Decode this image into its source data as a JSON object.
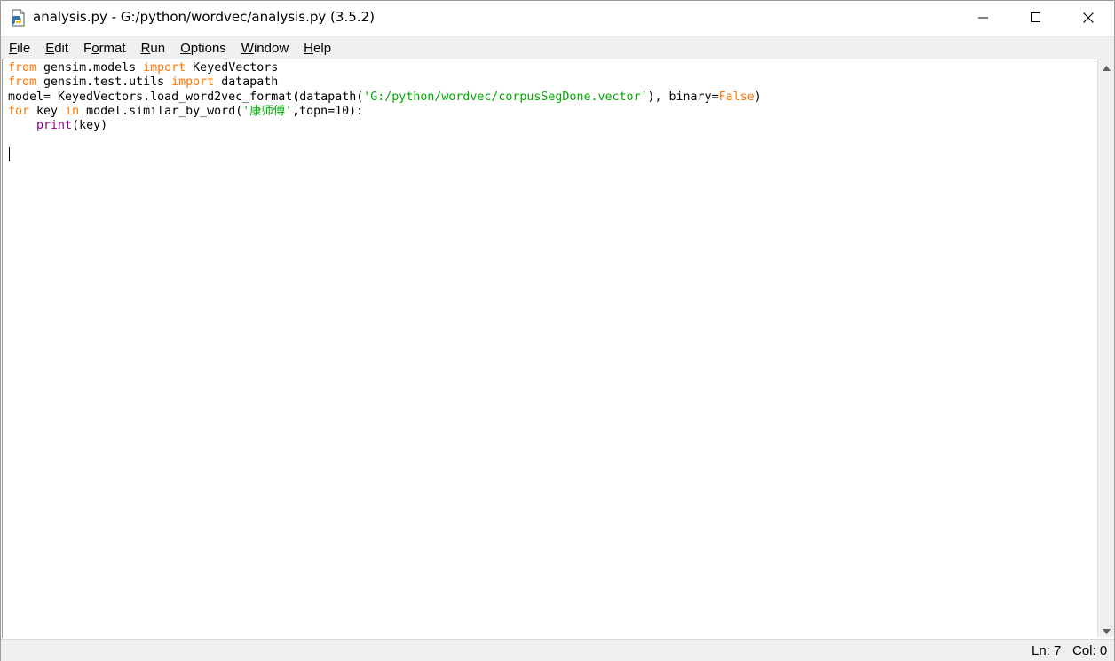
{
  "window": {
    "title": "analysis.py - G:/python/wordvec/analysis.py (3.5.2)",
    "minimize_icon": "minimize-icon",
    "maximize_icon": "maximize-icon",
    "close_icon": "close-icon"
  },
  "menu": [
    {
      "before": "",
      "accel": "F",
      "after": "ile"
    },
    {
      "before": "",
      "accel": "E",
      "after": "dit"
    },
    {
      "before": "F",
      "accel": "o",
      "after": "rmat"
    },
    {
      "before": "",
      "accel": "R",
      "after": "un"
    },
    {
      "before": "",
      "accel": "O",
      "after": "ptions"
    },
    {
      "before": "",
      "accel": "W",
      "after": "indow"
    },
    {
      "before": "",
      "accel": "H",
      "after": "elp"
    }
  ],
  "code": {
    "lines": [
      [
        [
          "kw",
          "from"
        ],
        [
          "n",
          " gensim.models "
        ],
        [
          "kw",
          "import"
        ],
        [
          "n",
          " KeyedVectors"
        ]
      ],
      [
        [
          "kw",
          "from"
        ],
        [
          "n",
          " gensim.test.utils "
        ],
        [
          "kw",
          "import"
        ],
        [
          "n",
          " datapath"
        ]
      ],
      [
        [
          "n",
          "model= KeyedVectors.load_word2vec_format(datapath("
        ],
        [
          "str",
          "'G:/python/wordvec/corpusSegDone.vector'"
        ],
        [
          "n",
          "), binary="
        ],
        [
          "kw",
          "False"
        ],
        [
          "n",
          ")"
        ]
      ],
      [
        [
          "kw",
          "for"
        ],
        [
          "n",
          " key "
        ],
        [
          "kw",
          "in"
        ],
        [
          "n",
          " model.similar_by_word("
        ],
        [
          "str",
          "'康师傅'"
        ],
        [
          "n",
          ",topn=10):"
        ]
      ],
      [
        [
          "n",
          "    "
        ],
        [
          "bi",
          "print"
        ],
        [
          "n",
          "(key)"
        ]
      ],
      [
        [
          "n",
          ""
        ]
      ],
      [
        [
          "n",
          ""
        ]
      ]
    ]
  },
  "colors": {
    "keyword": "#ff7700",
    "builtin": "#900090",
    "string": "#00aa00",
    "text": "#000000"
  },
  "status": {
    "ln": "Ln: 7",
    "col": "Col: 0"
  }
}
